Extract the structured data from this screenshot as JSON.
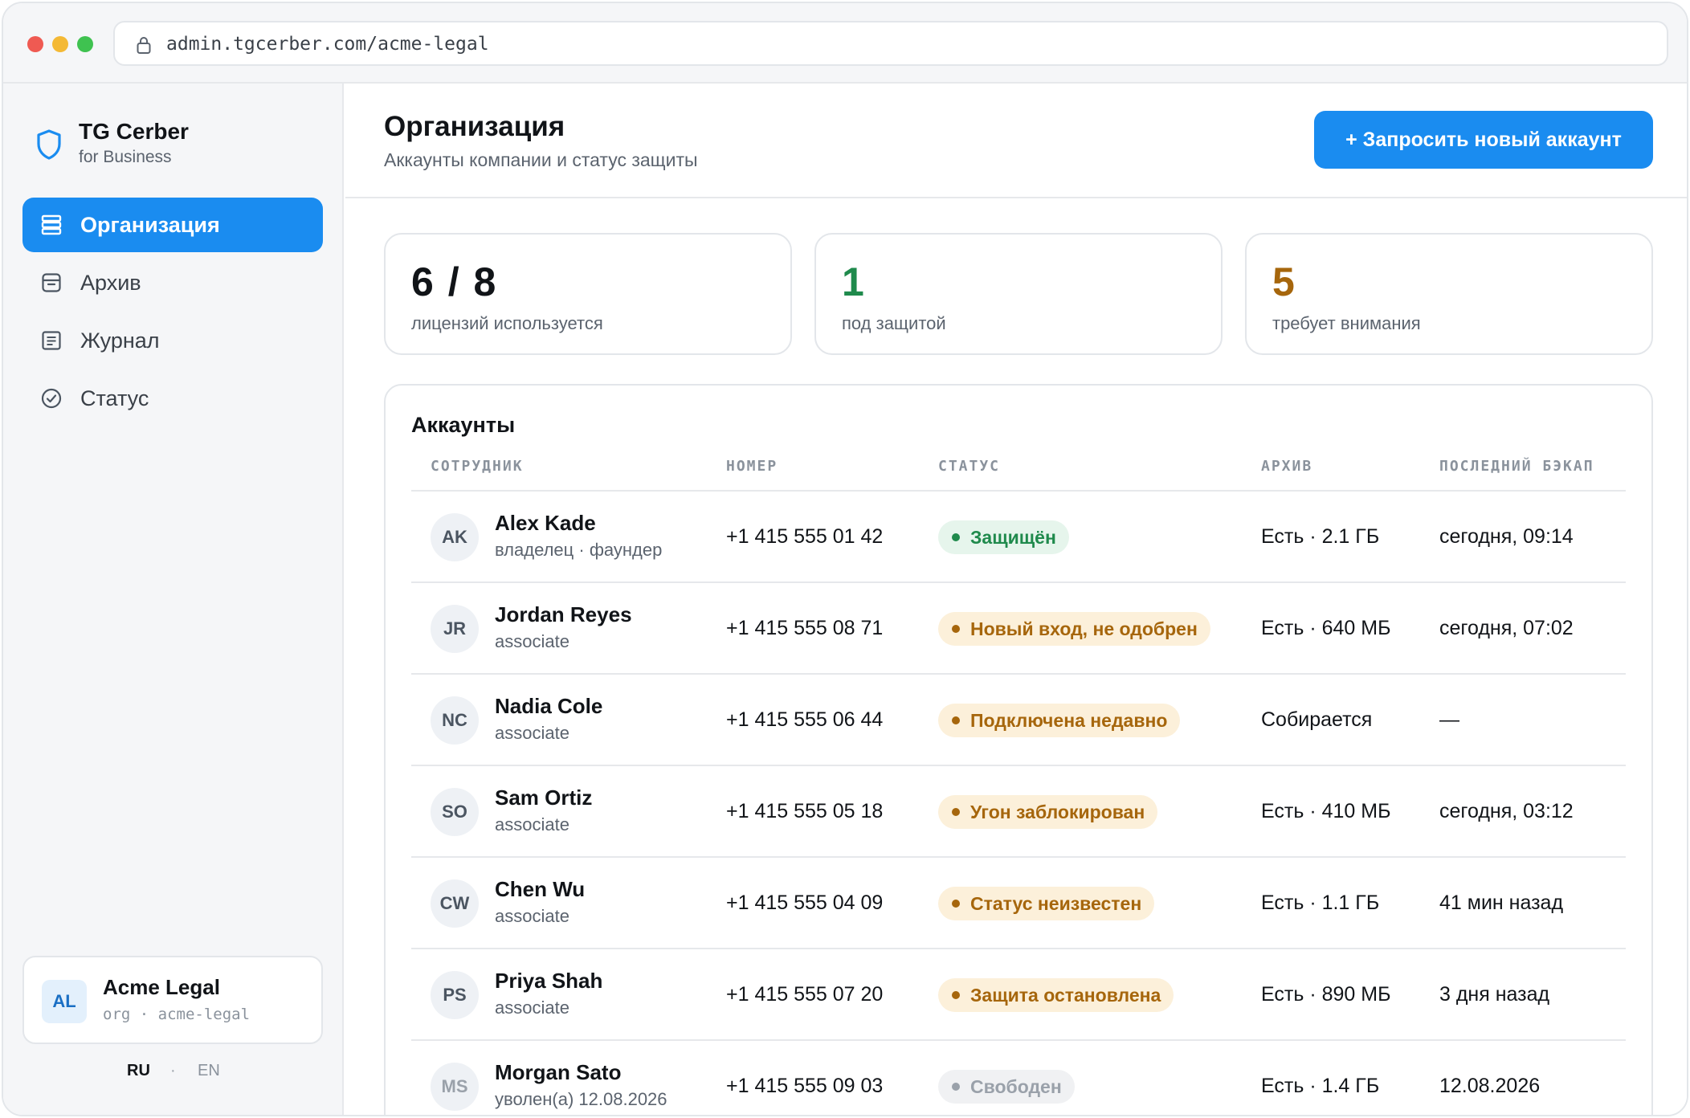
{
  "browser": {
    "url": "admin.tgcerber.com/acme-legal"
  },
  "sidebar": {
    "brand_name": "TG Cerber",
    "brand_sub": "for Business",
    "items": [
      {
        "label": "Организация",
        "icon": "stack-icon",
        "active": true
      },
      {
        "label": "Архив",
        "icon": "archive-icon",
        "active": false
      },
      {
        "label": "Журнал",
        "icon": "journal-icon",
        "active": false
      },
      {
        "label": "Статус",
        "icon": "check-circle-icon",
        "active": false
      }
    ],
    "org": {
      "initials": "AL",
      "name": "Acme Legal",
      "slug": "org · acme-legal"
    },
    "lang": {
      "ru": "RU",
      "sep": "·",
      "en": "EN"
    }
  },
  "header": {
    "title": "Организация",
    "subtitle": "Аккаунты компании и статус защиты",
    "cta_label": "+ Запросить новый аккаунт"
  },
  "stats": [
    {
      "value": "6 / 8",
      "label": "лицензий используется",
      "color": "#111418"
    },
    {
      "value": "1",
      "label": "под защитой",
      "color": "#1f8a4c"
    },
    {
      "value": "5",
      "label": "требует внимания",
      "color": "#a6660c"
    }
  ],
  "table": {
    "title": "Аккаунты",
    "columns": [
      "СОТРУДНИК",
      "НОМЕР",
      "СТАТУС",
      "АРХИВ",
      "ПОСЛЕДНИЙ БЭКАП"
    ],
    "rows": [
      {
        "initials": "AK",
        "name": "Alex Kade",
        "role": "владелец · фаундер",
        "phone": "+1 415 555 01 42",
        "status": "Защищён",
        "status_kind": "ok",
        "archive": "Есть · 2.1 ГБ",
        "backup": "сегодня, 09:14"
      },
      {
        "initials": "JR",
        "name": "Jordan Reyes",
        "role": "associate",
        "phone": "+1 415 555 08 71",
        "status": "Новый вход, не одобрен",
        "status_kind": "warn",
        "archive": "Есть · 640 МБ",
        "backup": "сегодня, 07:02"
      },
      {
        "initials": "NC",
        "name": "Nadia Cole",
        "role": "associate",
        "phone": "+1 415 555 06 44",
        "status": "Подключена недавно",
        "status_kind": "warn",
        "archive": "Собирается",
        "backup": "—"
      },
      {
        "initials": "SO",
        "name": "Sam Ortiz",
        "role": "associate",
        "phone": "+1 415 555 05 18",
        "status": "Угон заблокирован",
        "status_kind": "warn",
        "archive": "Есть · 410 МБ",
        "backup": "сегодня, 03:12"
      },
      {
        "initials": "CW",
        "name": "Chen Wu",
        "role": "associate",
        "phone": "+1 415 555 04 09",
        "status": "Статус неизвестен",
        "status_kind": "warn",
        "archive": "Есть · 1.1 ГБ",
        "backup": "41 мин назад"
      },
      {
        "initials": "PS",
        "name": "Priya Shah",
        "role": "associate",
        "phone": "+1 415 555 07 20",
        "status": "Защита остановлена",
        "status_kind": "warn",
        "archive": "Есть · 890 МБ",
        "backup": "3 дня назад"
      },
      {
        "initials": "MS",
        "name": "Morgan Sato",
        "role": "уволен(а) 12.08.2026",
        "phone": "+1 415 555 09 03",
        "status": "Свободен",
        "status_kind": "muted",
        "archive": "Есть · 1.4 ГБ",
        "backup": "12.08.2026"
      }
    ]
  },
  "colors": {
    "accent": "#1a8cf0",
    "ok": "#1f8a4c",
    "warn": "#a6660c"
  }
}
